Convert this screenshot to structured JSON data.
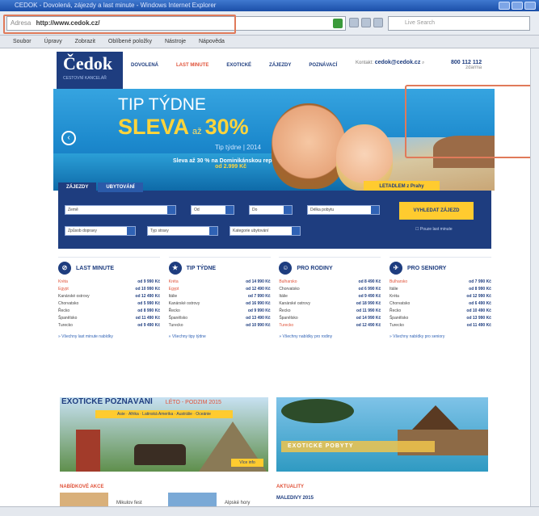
{
  "browser": {
    "title": "CEDOK - Dovolená, zájezdy a last minute - Windows Internet Explorer",
    "address_label": "Adresa",
    "url": "http://www.cedok.cz/",
    "search_placeholder": "Live Search",
    "menu": [
      "Soubor",
      "Úpravy",
      "Zobrazit",
      "Oblíbené položky",
      "Nástroje",
      "Nápověda"
    ]
  },
  "site": {
    "logo": "Čedok",
    "logo_tagline": "CESTOVNÍ KANCELÁŘ",
    "nav": [
      "DOVOLENÁ",
      "LAST MINUTE",
      "EXOTICKÉ",
      "ZÁJEZDY",
      "POZNÁVACÍ"
    ],
    "contact_label": "Kontakt:",
    "contact_value": "cedok@cedok.cz",
    "phone": "800 112 112",
    "phone_note": "zdarma"
  },
  "hero": {
    "tip": "TIP TÝDNE",
    "sleva": "SLEVA",
    "sleva_mid": "až",
    "sleva_pct": "30%",
    "line": "Tip týdne | 2014",
    "desc_line1": "Sleva až 30 % na Dominikánskou republiku",
    "desc_price": "od 2.999 Kč",
    "button": "LETADLEM z Prahy"
  },
  "search": {
    "tabs": [
      "ZÁJEZDY",
      "UBYTOVÁNÍ"
    ],
    "fields": [
      "Země",
      "Od",
      "Do",
      "Délka pobytu",
      "Způsob dopravy",
      "Typ stravy",
      "Kategorie ubytování"
    ],
    "button": "VYHLEDAT ZÁJEZD",
    "checkbox": "Pouze last minute"
  },
  "columns": [
    {
      "title": "LAST MINUTE",
      "icon": "⊘",
      "rows": [
        [
          "Kréta",
          "od 9 990 Kč"
        ],
        [
          "Egypt",
          "od 10 990 Kč"
        ],
        [
          "Kanárské ostrovy",
          "od 12 490 Kč"
        ],
        [
          "Chorvatsko",
          "od 5 990 Kč"
        ],
        [
          "Řecko",
          "od 8 990 Kč"
        ],
        [
          "Španělsko",
          "od 11 490 Kč"
        ],
        [
          "Turecko",
          "od 9 490 Kč"
        ]
      ],
      "more": "» Všechny last minute nabídky"
    },
    {
      "title": "TIP TÝDNE",
      "icon": "★",
      "rows": [
        [
          "Kréta",
          "od 14 990 Kč"
        ],
        [
          "Egypt",
          "od 12 490 Kč"
        ],
        [
          "Itálie",
          "od 7 990 Kč"
        ],
        [
          "Kanárské ostrovy",
          "od 16 990 Kč"
        ],
        [
          "Řecko",
          "od 9 990 Kč"
        ],
        [
          "Španělsko",
          "od 13 490 Kč"
        ],
        [
          "Turecko",
          "od 10 990 Kč"
        ]
      ],
      "more": "» Všechny tipy týdne"
    },
    {
      "title": "PRO RODINY",
      "icon": "☺",
      "rows": [
        [
          "Bulharsko",
          "od 8 490 Kč"
        ],
        [
          "Chorvatsko",
          "od 6 990 Kč"
        ],
        [
          "Itálie",
          "od 9 490 Kč"
        ],
        [
          "Kanárské ostrovy",
          "od 18 990 Kč"
        ],
        [
          "Řecko",
          "od 11 990 Kč"
        ],
        [
          "Španělsko",
          "od 14 990 Kč"
        ],
        [
          "Turecko",
          "od 12 490 Kč"
        ]
      ],
      "more": "» Všechny nabídky pro rodiny"
    },
    {
      "title": "PRO SENIORY",
      "icon": "✈",
      "rows": [
        [
          "Bulharsko",
          "od 7 990 Kč"
        ],
        [
          "Itálie",
          "od 8 990 Kč"
        ],
        [
          "Kréta",
          "od 12 990 Kč"
        ],
        [
          "Chorvatsko",
          "od 6 490 Kč"
        ],
        [
          "Řecko",
          "od 10 490 Kč"
        ],
        [
          "Španělsko",
          "od 13 990 Kč"
        ],
        [
          "Turecko",
          "od 11 490 Kč"
        ]
      ],
      "more": "» Všechny nabídky pro seniory"
    }
  ],
  "promo1": {
    "title": "EXOTICKÉ POZNÁVÁNÍ",
    "subtitle": "LÉTO - PODZIM 2015",
    "ribbon": "Asie · Afrika · Latinská Amerika · Austrálie · Oceánie",
    "button": "Více info"
  },
  "promo2": {
    "text": "EXOTICKÉ POBYTY"
  },
  "bottom": {
    "left_heading": "NABÍDKOVÉ AKCE",
    "left_label1": "Mikulov fest",
    "left_label2": "Alpské hory",
    "right_heading": "AKTUALITY",
    "right_label": "MALEDIVY 2015"
  }
}
